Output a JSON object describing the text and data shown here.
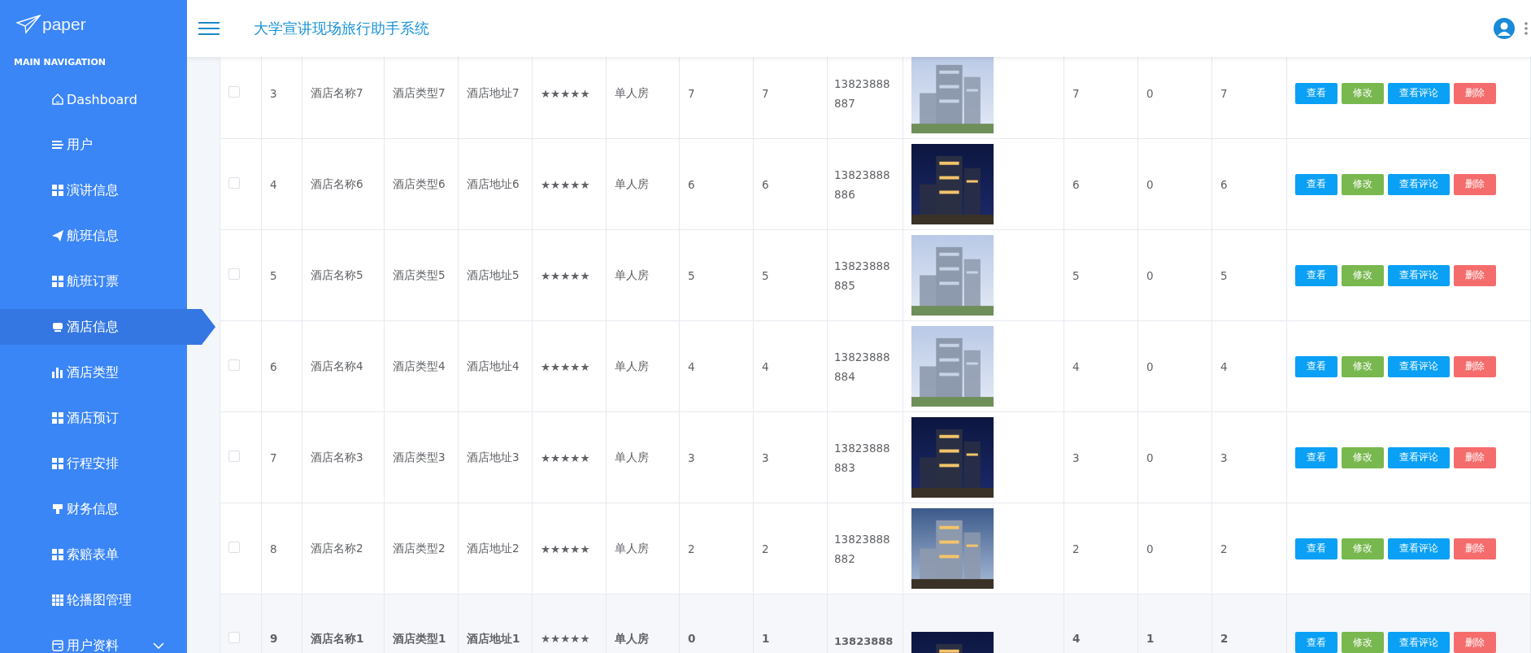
{
  "sidebar": {
    "logo": "paper",
    "section_title": "MAIN NAVIGATION",
    "items": [
      {
        "label": "Dashboard",
        "selected": false,
        "kind": "link"
      },
      {
        "label": "用户",
        "selected": false,
        "kind": "link"
      },
      {
        "label": "演讲信息",
        "selected": false,
        "kind": "link"
      },
      {
        "label": "航班信息",
        "selected": false,
        "kind": "link"
      },
      {
        "label": "航班订票",
        "selected": false,
        "kind": "link"
      },
      {
        "label": "酒店信息",
        "selected": true,
        "kind": "link"
      },
      {
        "label": "酒店类型",
        "selected": false,
        "kind": "link"
      },
      {
        "label": "酒店预订",
        "selected": false,
        "kind": "link"
      },
      {
        "label": "行程安排",
        "selected": false,
        "kind": "link"
      },
      {
        "label": "财务信息",
        "selected": false,
        "kind": "link"
      },
      {
        "label": "索赔表单",
        "selected": false,
        "kind": "link"
      },
      {
        "label": "轮播图管理",
        "selected": false,
        "kind": "link"
      },
      {
        "label": "用户资料",
        "selected": false,
        "kind": "submenu",
        "expanded": false
      }
    ]
  },
  "header": {
    "title": "大学宣讲现场旅行助手系统"
  },
  "table": {
    "rows": [
      {
        "checked": false,
        "highlighted": false,
        "id": "3",
        "name": "酒店名称7",
        "type": "酒店类型7",
        "address": "酒店地址7",
        "rating": "★★★★★",
        "room": "单人房",
        "column_8": "7",
        "column_9": "7",
        "phone": "13823888887",
        "column_12": "7",
        "column_13": "0",
        "column_14": "7",
        "actions": [
          {
            "label": "查看",
            "kind": "primary"
          },
          {
            "label": "修改",
            "kind": "success"
          },
          {
            "label": "查看评论",
            "kind": "primary"
          },
          {
            "label": "删除",
            "kind": "danger"
          }
        ]
      },
      {
        "checked": false,
        "highlighted": false,
        "id": "4",
        "name": "酒店名称6",
        "type": "酒店类型6",
        "address": "酒店地址6",
        "rating": "★★★★★",
        "room": "单人房",
        "column_8": "6",
        "column_9": "6",
        "phone": "13823888886",
        "column_12": "6",
        "column_13": "0",
        "column_14": "6",
        "actions": [
          {
            "label": "查看",
            "kind": "primary"
          },
          {
            "label": "修改",
            "kind": "success"
          },
          {
            "label": "查看评论",
            "kind": "primary"
          },
          {
            "label": "删除",
            "kind": "danger"
          }
        ]
      },
      {
        "checked": false,
        "highlighted": false,
        "id": "5",
        "name": "酒店名称5",
        "type": "酒店类型5",
        "address": "酒店地址5",
        "rating": "★★★★★",
        "room": "单人房",
        "column_8": "5",
        "column_9": "5",
        "phone": "13823888885",
        "column_12": "5",
        "column_13": "0",
        "column_14": "5",
        "actions": [
          {
            "label": "查看",
            "kind": "primary"
          },
          {
            "label": "修改",
            "kind": "success"
          },
          {
            "label": "查看评论",
            "kind": "primary"
          },
          {
            "label": "删除",
            "kind": "danger"
          }
        ]
      },
      {
        "checked": false,
        "highlighted": false,
        "id": "6",
        "name": "酒店名称4",
        "type": "酒店类型4",
        "address": "酒店地址4",
        "rating": "★★★★★",
        "room": "单人房",
        "column_8": "4",
        "column_9": "4",
        "phone": "13823888884",
        "column_12": "4",
        "column_13": "0",
        "column_14": "4",
        "actions": [
          {
            "label": "查看",
            "kind": "primary"
          },
          {
            "label": "修改",
            "kind": "success"
          },
          {
            "label": "查看评论",
            "kind": "primary"
          },
          {
            "label": "删除",
            "kind": "danger"
          }
        ]
      },
      {
        "checked": false,
        "highlighted": false,
        "id": "7",
        "name": "酒店名称3",
        "type": "酒店类型3",
        "address": "酒店地址3",
        "rating": "★★★★★",
        "room": "单人房",
        "column_8": "3",
        "column_9": "3",
        "phone": "13823888883",
        "column_12": "3",
        "column_13": "0",
        "column_14": "3",
        "actions": [
          {
            "label": "查看",
            "kind": "primary"
          },
          {
            "label": "修改",
            "kind": "success"
          },
          {
            "label": "查看评论",
            "kind": "primary"
          },
          {
            "label": "删除",
            "kind": "danger"
          }
        ]
      },
      {
        "checked": false,
        "highlighted": false,
        "id": "8",
        "name": "酒店名称2",
        "type": "酒店类型2",
        "address": "酒店地址2",
        "rating": "★★★★★",
        "room": "单人房",
        "column_8": "2",
        "column_9": "2",
        "phone": "13823888882",
        "column_12": "2",
        "column_13": "0",
        "column_14": "2",
        "actions": [
          {
            "label": "查看",
            "kind": "primary"
          },
          {
            "label": "修改",
            "kind": "success"
          },
          {
            "label": "查看评论",
            "kind": "primary"
          },
          {
            "label": "删除",
            "kind": "danger"
          }
        ]
      },
      {
        "checked": false,
        "highlighted": true,
        "id": "9",
        "name": "酒店名称1",
        "type": "酒店类型1",
        "address": "酒店地址1",
        "rating": "★★★★★",
        "room": "单人房",
        "column_8": "0",
        "column_9": "1",
        "phone": "13823888",
        "column_12": "4",
        "column_13": "1",
        "column_14": "2",
        "actions": [
          {
            "label": "查看",
            "kind": "primary"
          },
          {
            "label": "修改",
            "kind": "success"
          },
          {
            "label": "查看评论",
            "kind": "primary"
          },
          {
            "label": "删除",
            "kind": "danger"
          }
        ]
      }
    ]
  }
}
